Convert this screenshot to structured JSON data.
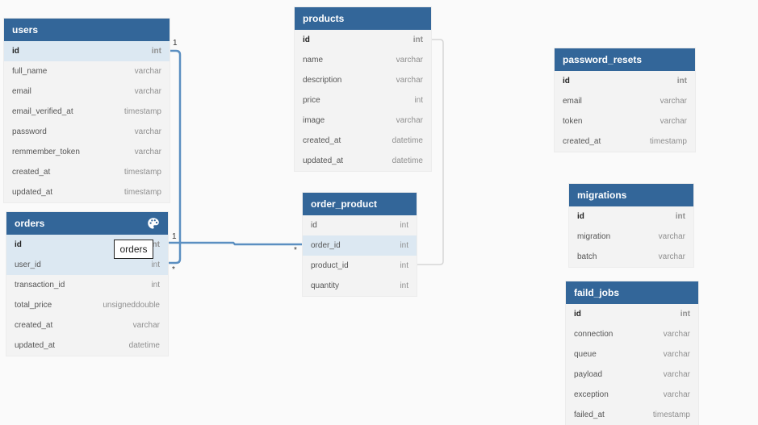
{
  "tables": {
    "users": {
      "title": "users",
      "rows": [
        {
          "name": "id",
          "type": "int"
        },
        {
          "name": "full_name",
          "type": "varchar"
        },
        {
          "name": "email",
          "type": "varchar"
        },
        {
          "name": "email_verified_at",
          "type": "timestamp"
        },
        {
          "name": "password",
          "type": "varchar"
        },
        {
          "name": "remmember_token",
          "type": "varchar"
        },
        {
          "name": "created_at",
          "type": "timestamp"
        },
        {
          "name": "updated_at",
          "type": "timestamp"
        }
      ]
    },
    "orders": {
      "title": "orders",
      "icon": "palette-icon",
      "rows": [
        {
          "name": "id",
          "type": "int"
        },
        {
          "name": "user_id",
          "type": "int"
        },
        {
          "name": "transaction_id",
          "type": "int"
        },
        {
          "name": "total_price",
          "type": "unsigneddouble"
        },
        {
          "name": "created_at",
          "type": "varchar"
        },
        {
          "name": "updated_at",
          "type": "datetime"
        }
      ]
    },
    "products": {
      "title": "products",
      "rows": [
        {
          "name": "id",
          "type": "int"
        },
        {
          "name": "name",
          "type": "varchar"
        },
        {
          "name": "description",
          "type": "varchar"
        },
        {
          "name": "price",
          "type": "int"
        },
        {
          "name": "image",
          "type": "varchar"
        },
        {
          "name": "created_at",
          "type": "datetime"
        },
        {
          "name": "updated_at",
          "type": "datetime"
        }
      ]
    },
    "order_product": {
      "title": "order_product",
      "rows": [
        {
          "name": "id",
          "type": "int"
        },
        {
          "name": "order_id",
          "type": "int"
        },
        {
          "name": "product_id",
          "type": "int"
        },
        {
          "name": "quantity",
          "type": "int"
        }
      ]
    },
    "password_resets": {
      "title": "password_resets",
      "rows": [
        {
          "name": "id",
          "type": "int"
        },
        {
          "name": "email",
          "type": "varchar"
        },
        {
          "name": "token",
          "type": "varchar"
        },
        {
          "name": "created_at",
          "type": "timestamp"
        }
      ]
    },
    "migrations": {
      "title": "migrations",
      "rows": [
        {
          "name": "id",
          "type": "int"
        },
        {
          "name": "migration",
          "type": "varchar"
        },
        {
          "name": "batch",
          "type": "varchar"
        }
      ]
    },
    "faild_jobs": {
      "title": "faild_jobs",
      "rows": [
        {
          "name": "id",
          "type": "int"
        },
        {
          "name": "connection",
          "type": "varchar"
        },
        {
          "name": "queue",
          "type": "varchar"
        },
        {
          "name": "payload",
          "type": "varchar"
        },
        {
          "name": "exception",
          "type": "varchar"
        },
        {
          "name": "failed_at",
          "type": "timestamp"
        }
      ]
    }
  },
  "relations": {
    "users_orders": {
      "from_card": "1",
      "to_card": "*"
    },
    "orders_order_product": {
      "from_card": "1",
      "to_card": "*"
    }
  },
  "tooltip": "orders",
  "colors": {
    "header": "#336699",
    "relation_active": "#5b8fc1",
    "relation_inactive": "#d6d6d6",
    "highlight_row": "#dce8f2"
  }
}
